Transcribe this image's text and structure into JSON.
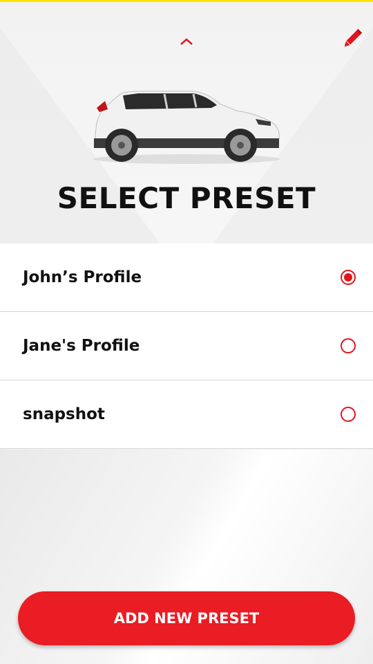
{
  "colors": {
    "accent": "#ea1c24",
    "top_bar": "#ffe600",
    "text": "#111111"
  },
  "header": {
    "collapse_icon": "chevron-up-icon",
    "edit_icon": "pencil-icon",
    "title": "SELECT PRESET"
  },
  "presets": [
    {
      "label": "John’s Profile",
      "selected": true
    },
    {
      "label": "Jane's Profile",
      "selected": false
    },
    {
      "label": "snapshot",
      "selected": false
    }
  ],
  "actions": {
    "add_label": "ADD NEW PRESET"
  }
}
